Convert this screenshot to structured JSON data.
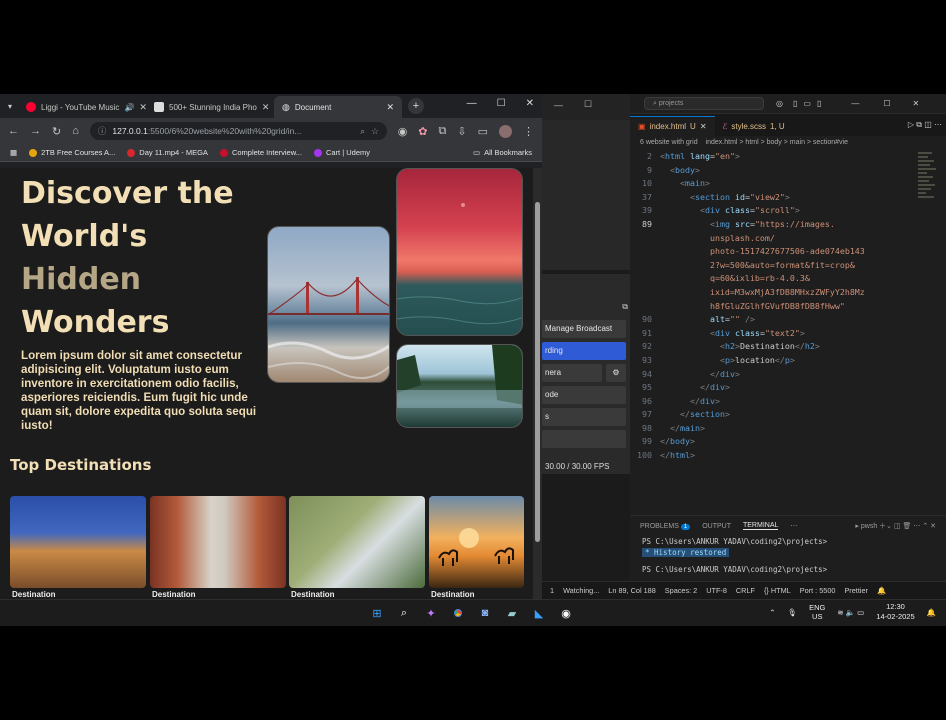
{
  "chrome": {
    "tabs": [
      {
        "title": "Liggi - YouTube Music",
        "color": "#ff0033"
      },
      {
        "title": "500+ Stunning India Pho",
        "color": "#444444"
      },
      {
        "title": "Document",
        "color": "#8a8a8a"
      }
    ],
    "url_host": "127.0.0.1",
    "url_rest": ":5500/6%20website%20with%20grid/in...",
    "bookmarks": [
      "2TB Free Courses A...",
      "Day 11.mp4 - MEGA",
      "Complete Interview...",
      "Cart | Udemy"
    ],
    "all_bookmarks": "All Bookmarks"
  },
  "page": {
    "hero_line1": "Discover the",
    "hero_line2": "World's",
    "hero_line3": "Hidden",
    "hero_line4": "Wonders",
    "hero_paragraph": "Lorem ipsum dolor sit amet consectetur adipisicing elit. Voluptatum iusto eum inventore in exercitationem odio facilis, asperiores reiciendis. Eum fugit hic unde quam sit, dolore expedita quo soluta sequi iusto!",
    "section_title": "Top Destinations",
    "card_caption": "Destination"
  },
  "obs": {
    "manage_broadcast": "Manage Broadcast",
    "recording": "rding",
    "camera": "nera",
    "mode": "ode",
    "s": "s",
    "fps": "30.00 / 30.00 FPS"
  },
  "vscode": {
    "search": "projects",
    "tab1": "index.html",
    "tab1_flag": "U",
    "tab2": "style.scss",
    "tab2_flag": "1, U",
    "breadcrumb_left": "6 website with grid",
    "breadcrumb_right": "index.html > html > body > main > section#vie",
    "line_numbers": [
      "2",
      "9",
      "10",
      "37",
      "39",
      "89",
      "",
      "",
      "",
      "",
      "",
      "",
      "90",
      "91",
      "92",
      "93",
      "94",
      "95",
      "96",
      "97",
      "98",
      "99",
      "100"
    ],
    "panel_tabs": [
      "PROBLEMS",
      "OUTPUT",
      "TERMINAL"
    ],
    "problems_count": "1",
    "shell": "pwsh",
    "terminal_prompt1": "PS C:\\Users\\ANKUR YADAV\\coding2\\projects>",
    "history_restored": "History restored",
    "terminal_prompt2": "PS C:\\Users\\ANKUR YADAV\\coding2\\projects>",
    "status": [
      "1",
      "Watching...",
      "Ln 89, Col 188",
      "Spaces: 2",
      "UTF-8",
      "CRLF",
      "{} HTML",
      "Port : 5500",
      "Prettier"
    ]
  },
  "taskbar": {
    "lang1": "ENG",
    "lang2": "US",
    "time": "12:30",
    "date": "14-02-2025"
  }
}
